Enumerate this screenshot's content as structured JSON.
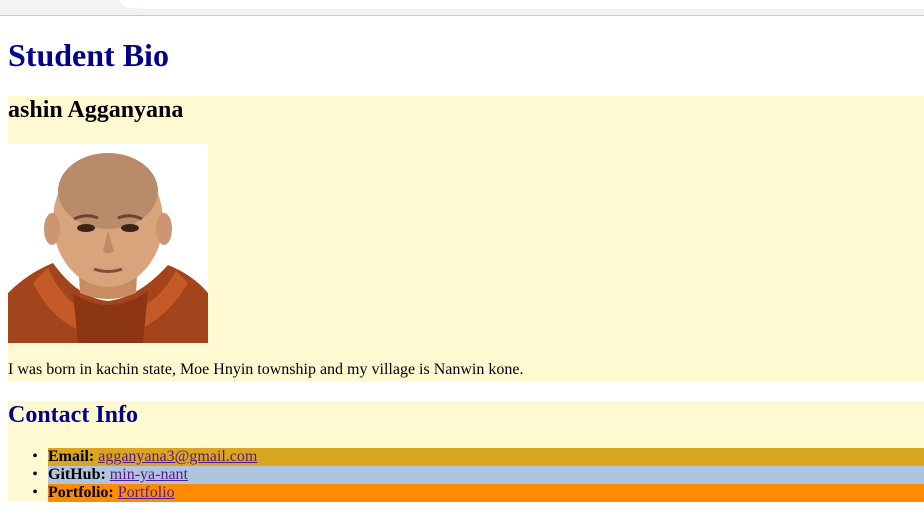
{
  "page": {
    "title": "Student Bio"
  },
  "bio": {
    "name": "ashin Agganyana",
    "photo_alt": "photo of ashin Agganyana",
    "text": "I was born in kachin state, Moe Hnyin township and my village is Nanwin kone."
  },
  "contact": {
    "heading": "Contact Info",
    "items": [
      {
        "label": "Email:",
        "link": "agganyana3@gmail.com",
        "bg": "#daa520"
      },
      {
        "label": "GitHub:",
        "link": "min-ya-nant",
        "bg": "#b0c4de"
      },
      {
        "label": "Portfolio:",
        "link": "Portfolio",
        "bg": "#ff8c00"
      }
    ]
  },
  "colors": {
    "heading": "#00008b",
    "section_bg": "#fff9d2",
    "link": "#551a8b"
  }
}
